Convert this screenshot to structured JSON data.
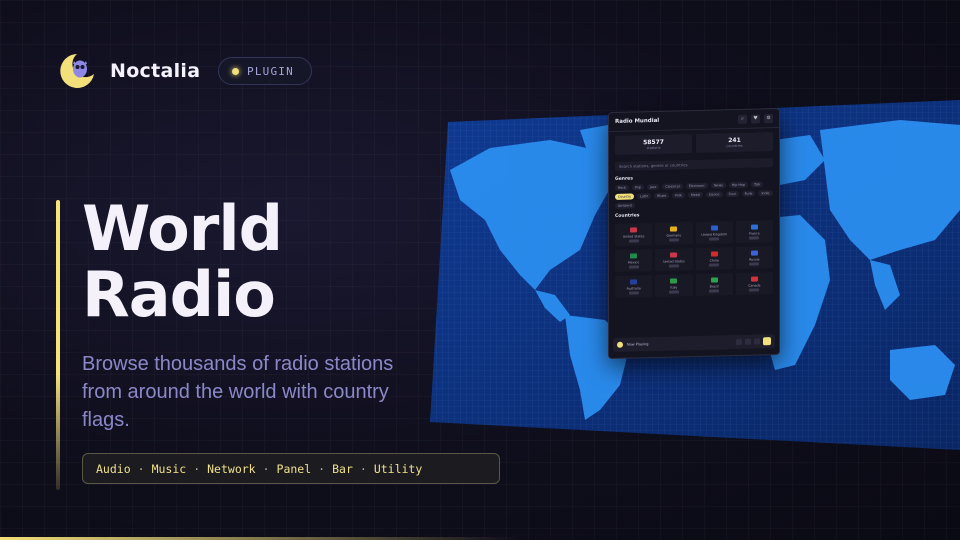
{
  "brand": {
    "name": "Noctalia",
    "badge": "PLUGIN"
  },
  "hero": {
    "title_line1": "World",
    "title_line2": "Radio",
    "description": "Browse thousands of radio stations from around the world with country flags."
  },
  "tags": [
    "Audio",
    "Music",
    "Network",
    "Panel",
    "Bar",
    "Utility"
  ],
  "colors": {
    "accent": "#f3e07a",
    "text_muted": "#8b88c9",
    "map_land": "#2b8ef0",
    "map_sea": "#0d2f7a"
  },
  "app_panel": {
    "title": "Radio Mundial",
    "stats": [
      {
        "value": "58577",
        "label": "stations"
      },
      {
        "value": "241",
        "label": "countries"
      }
    ],
    "search_placeholder": "Search stations, genres or countries",
    "genres_label": "Genres",
    "stations_label": "Countries",
    "genres": [
      "Rock",
      "Pop",
      "Jazz",
      "Classical",
      "Electronic",
      "News",
      "Hip Hop",
      "Talk",
      "Country",
      "Latin",
      "Blues",
      "Folk",
      "Metal",
      "Dance",
      "Soul",
      "Funk",
      "Indie",
      "Ambient"
    ],
    "active_genre": "Country",
    "stations": [
      "United States",
      "Germany",
      "United Kingdom",
      "France",
      "Mexico",
      "United States",
      "China",
      "Russia",
      "Australia",
      "Italy",
      "Brazil",
      "Canada"
    ],
    "player_now": "Now Playing"
  }
}
